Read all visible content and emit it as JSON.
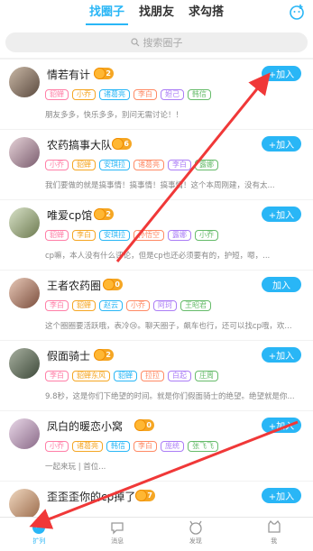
{
  "top_tabs": [
    "找圈子",
    "找朋友",
    "求勾搭"
  ],
  "search": {
    "placeholder": "搜索圈子"
  },
  "join_label": "+加入",
  "join_label_plain": "加入",
  "groups": [
    {
      "name": "情若有计",
      "level": "2",
      "tags": [
        "貂蝉",
        "小乔",
        "诸葛亮",
        "李白",
        "妲己",
        "韩信"
      ],
      "desc": "朋友多多，快乐多多，别问无需讨论！！"
    },
    {
      "name": "农药搞事大队",
      "level": "6",
      "tags": [
        "小乔",
        "貂蝉",
        "安琪拉",
        "诸葛亮",
        "李白",
        "露娜"
      ],
      "desc": "我们要做的就是搞事情！搞事情！搞事情！这个本周刚建，没有太..."
    },
    {
      "name": "唯爱cp馆",
      "level": "2",
      "tags": [
        "貂蝉",
        "李白",
        "安琪拉",
        "孙悟空",
        "露娜",
        "小乔"
      ],
      "desc": "cp嘛，本人没有什么评论，但是cp也还必须要有的，护短，嗯，..."
    },
    {
      "name": "王者农药圈",
      "level": "0",
      "tags": [
        "李白",
        "貂蝉",
        "赵云",
        "小乔",
        "阿珂",
        "王昭君"
      ],
      "desc": "这个圈圈要活跃哦，表冷😢。聊天圈子，飙车也行，还可以找cp哦，欢..."
    },
    {
      "name": "假面骑士",
      "level": "2",
      "tags": [
        "李白",
        "貂蝉东风",
        "貂蝉",
        "拉拉",
        "白起",
        "庄周"
      ],
      "desc": "9.8秒，这是你们下绝望的时间。就是你们假面骑士的绝望。绝望就是你..."
    },
    {
      "name": "凤白的暖恋小窝",
      "level": "0",
      "tags": [
        "小乔",
        "诸葛亮",
        "韩信",
        "李白",
        "庞统",
        "张飞飞"
      ],
      "desc": "一起来玩 | 首位..."
    },
    {
      "name": "歪歪歪你的cp掉了",
      "level": "7",
      "tags": [],
      "desc": ""
    }
  ],
  "bottom_nav": [
    "扩列",
    "消息",
    "发现",
    "我"
  ],
  "colors": {
    "accent": "#29b6f6",
    "level": "#f5a623",
    "annotation_arrow": "#f03838"
  }
}
